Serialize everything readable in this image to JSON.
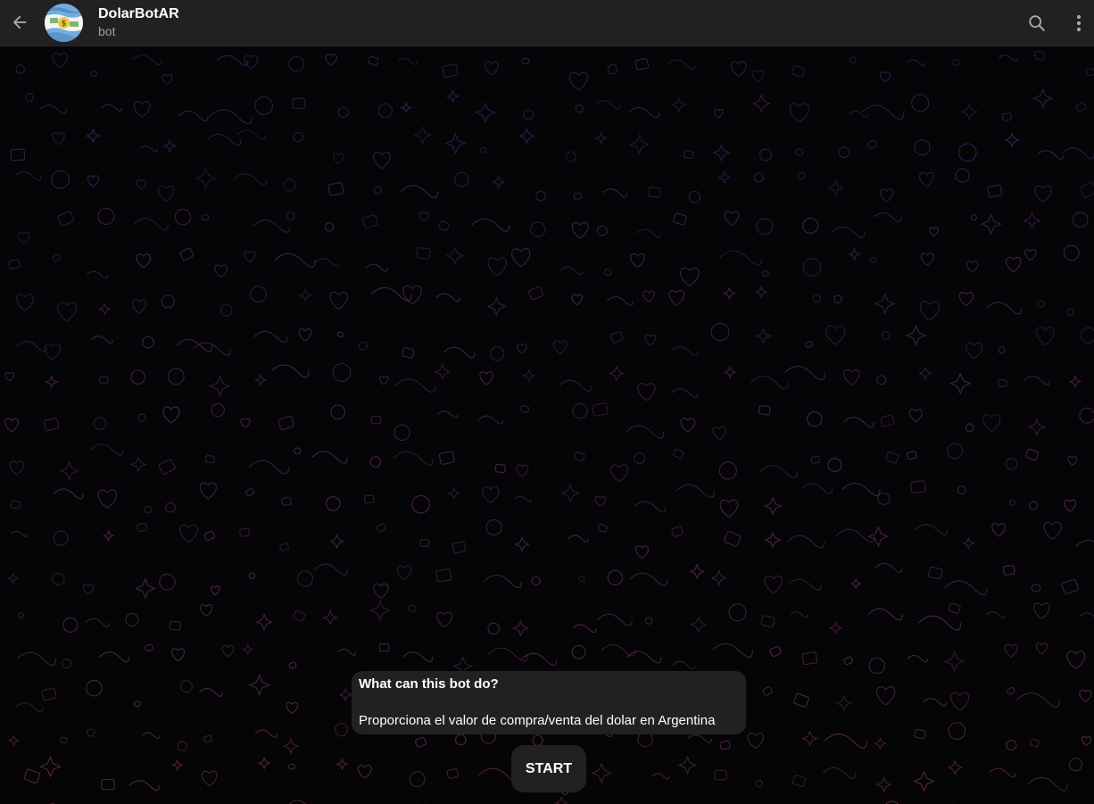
{
  "header": {
    "back_icon": "arrow-left-icon",
    "avatar": "argentina-flag-dollar-avatar",
    "title": "DolarBotAR",
    "subtitle": "bot",
    "search_icon": "search-icon",
    "more_icon": "more-vertical-icon"
  },
  "bot_info": {
    "title": "What can this bot do?",
    "description": "Proporciona el valor de compra/venta del dolar en Argentina"
  },
  "start_button": {
    "label": "START"
  },
  "colors": {
    "header_bg": "#212121",
    "chat_bg": "#050406",
    "bubble_bg": "#212121",
    "pattern_top": "#3a1f5a",
    "pattern_bottom": "#5a2a40"
  }
}
